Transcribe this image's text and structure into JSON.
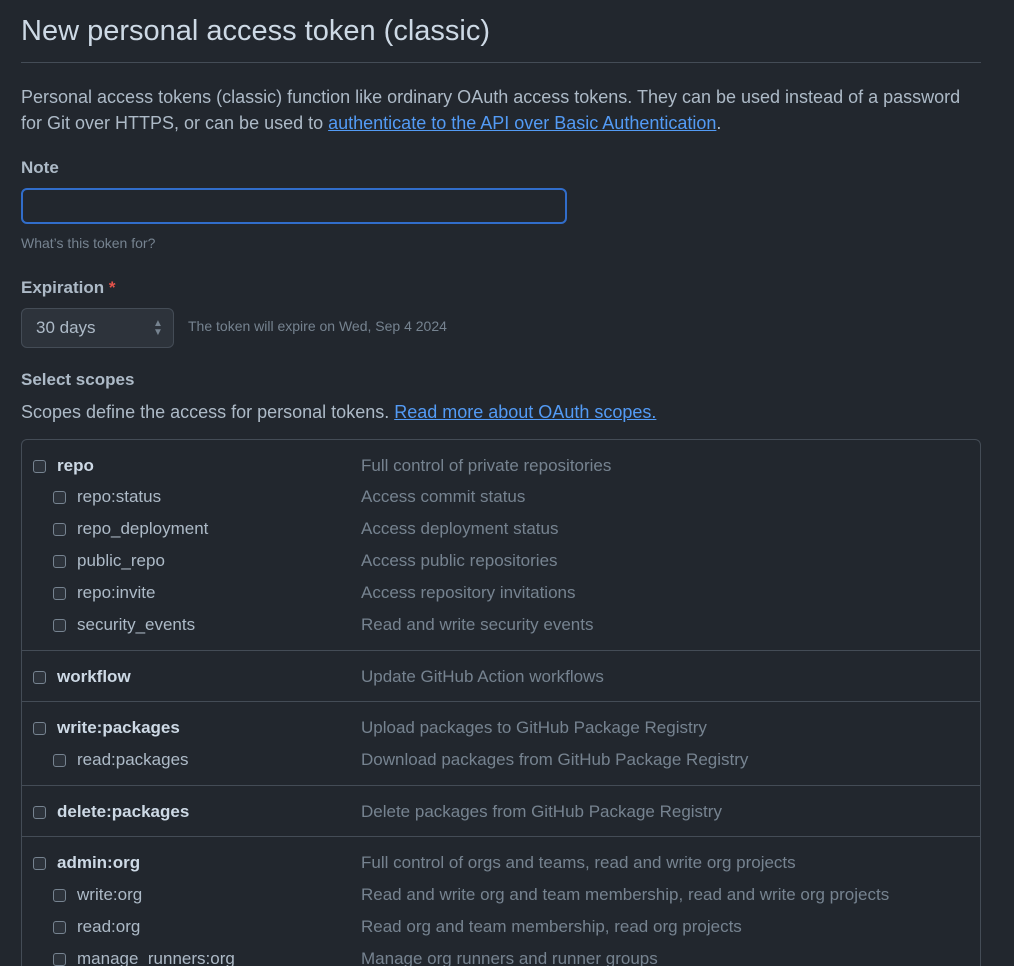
{
  "page": {
    "title": "New personal access token (classic)",
    "intro_text": "Personal access tokens (classic) function like ordinary OAuth access tokens. They can be used instead of a password for Git over HTTPS, or can be used to ",
    "intro_link": "authenticate to the API over Basic Authentication",
    "intro_end": "."
  },
  "note": {
    "label": "Note",
    "value": "",
    "hint": "What’s this token for?"
  },
  "expiration": {
    "label": "Expiration",
    "required_mark": "*",
    "selected": "30 days",
    "info": "The token will expire on Wed, Sep 4 2024"
  },
  "scopes": {
    "label": "Select scopes",
    "description": "Scopes define the access for personal tokens. ",
    "link": "Read more about OAuth scopes.",
    "rows": [
      {
        "name": "repo",
        "desc": "Full control of private repositories",
        "parent": true,
        "checked": false
      },
      {
        "name": "repo:status",
        "desc": "Access commit status",
        "parent": false,
        "checked": false
      },
      {
        "name": "repo_deployment",
        "desc": "Access deployment status",
        "parent": false,
        "checked": false
      },
      {
        "name": "public_repo",
        "desc": "Access public repositories",
        "parent": false,
        "checked": false
      },
      {
        "name": "repo:invite",
        "desc": "Access repository invitations",
        "parent": false,
        "checked": false
      },
      {
        "name": "security_events",
        "desc": "Read and write security events",
        "parent": false,
        "checked": false
      },
      {
        "name": "workflow",
        "desc": "Update GitHub Action workflows",
        "parent": true,
        "checked": false
      },
      {
        "name": "write:packages",
        "desc": "Upload packages to GitHub Package Registry",
        "parent": true,
        "checked": false
      },
      {
        "name": "read:packages",
        "desc": "Download packages from GitHub Package Registry",
        "parent": false,
        "checked": false
      },
      {
        "name": "delete:packages",
        "desc": "Delete packages from GitHub Package Registry",
        "parent": true,
        "checked": false
      },
      {
        "name": "admin:org",
        "desc": "Full control of orgs and teams, read and write org projects",
        "parent": true,
        "checked": false
      },
      {
        "name": "write:org",
        "desc": "Read and write org and team membership, read and write org projects",
        "parent": false,
        "checked": false
      },
      {
        "name": "read:org",
        "desc": "Read org and team membership, read org projects",
        "parent": false,
        "checked": false
      },
      {
        "name": "manage_runners:org",
        "desc": "Manage org runners and runner groups",
        "parent": false,
        "checked": false
      }
    ]
  },
  "colors": {
    "background": "#22272e",
    "link": "#539bf5",
    "focus_border": "#316dca",
    "required": "#e5534b"
  }
}
